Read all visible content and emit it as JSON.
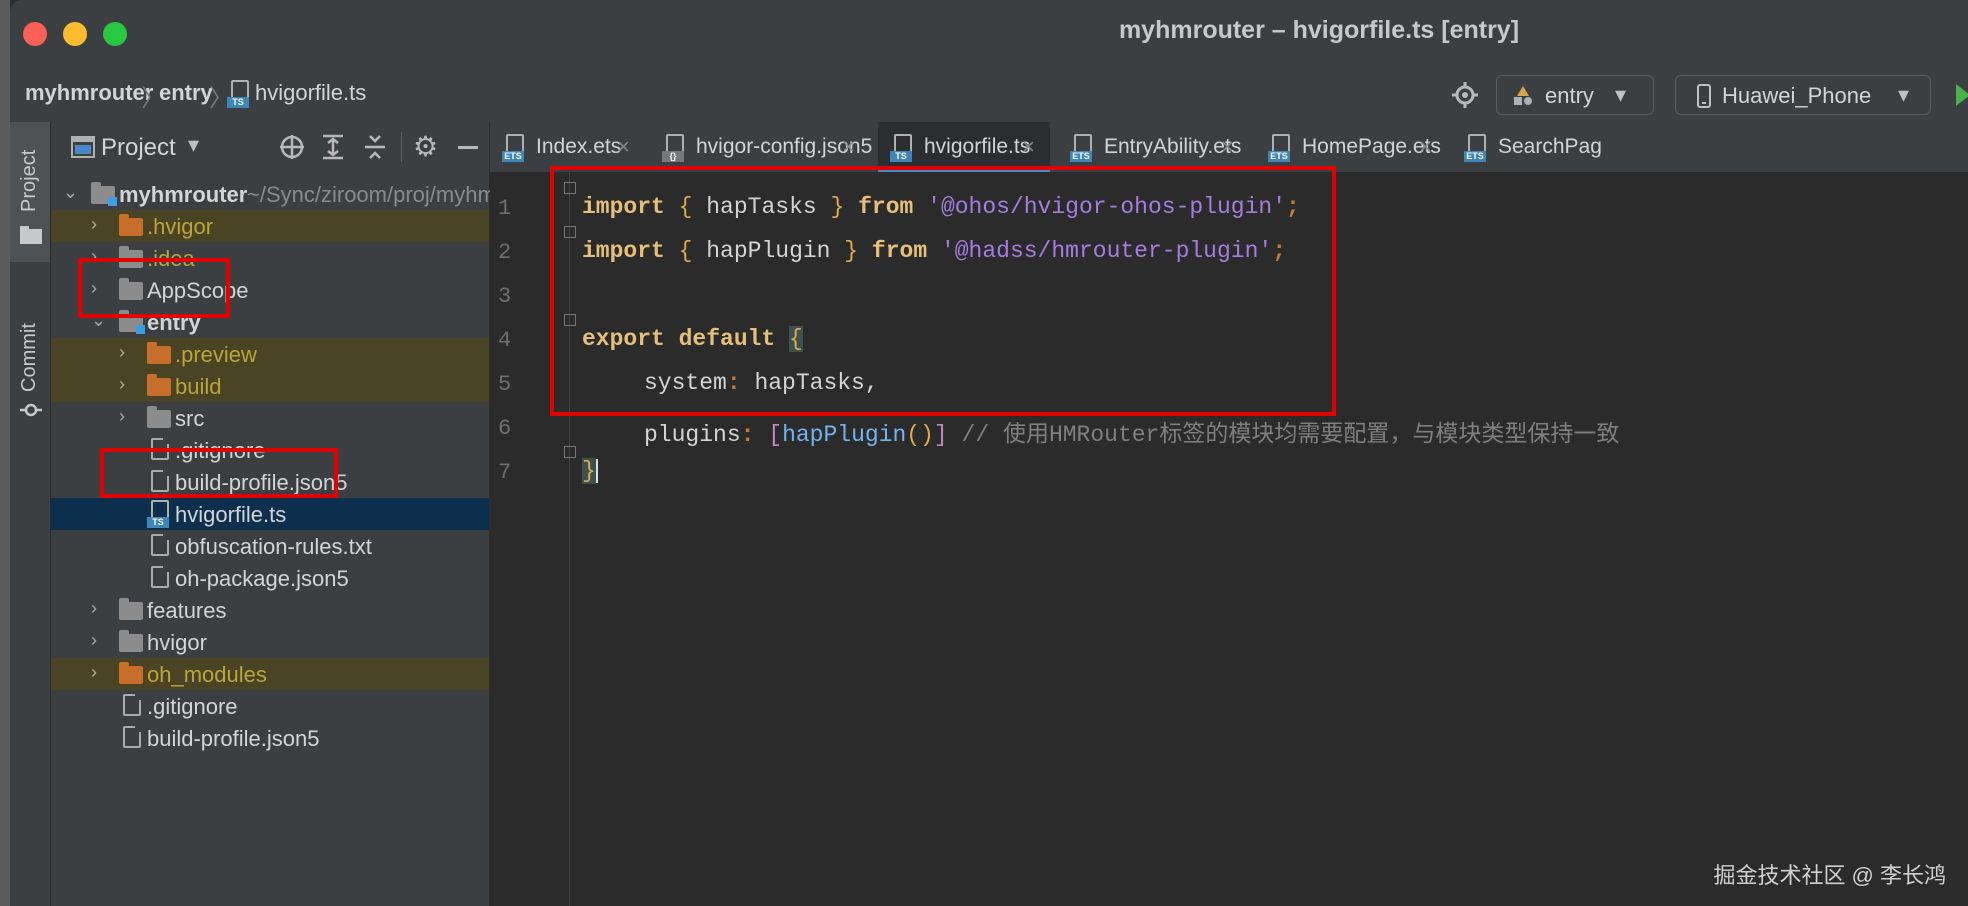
{
  "window": {
    "title": "myhmrouter – hvigorfile.ts [entry]"
  },
  "breadcrumb": [
    "myhmrouter",
    "entry",
    "hvigorfile.ts"
  ],
  "toolbar": {
    "module": "entry",
    "device": "Huawei_Phone"
  },
  "side_tabs": {
    "project": "Project",
    "commit": "Commit"
  },
  "project_panel": {
    "title": "Project",
    "tree": [
      {
        "label": "myhmrouter",
        "suffix": "~/Sync/ziroom/proj/myhm",
        "type": "module-root",
        "expanded": true
      },
      {
        "label": ".hvigor",
        "type": "folder-excluded"
      },
      {
        "label": ".idea",
        "type": "folder-gray-text"
      },
      {
        "label": "AppScope",
        "type": "folder"
      },
      {
        "label": "entry",
        "type": "module",
        "expanded": true
      },
      {
        "label": ".preview",
        "type": "folder-excluded"
      },
      {
        "label": "build",
        "type": "folder-excluded"
      },
      {
        "label": "src",
        "type": "folder"
      },
      {
        "label": ".gitignore",
        "type": "file"
      },
      {
        "label": "build-profile.json5",
        "type": "file"
      },
      {
        "label": "hvigorfile.ts",
        "type": "file-ts",
        "selected": true
      },
      {
        "label": "obfuscation-rules.txt",
        "type": "file"
      },
      {
        "label": "oh-package.json5",
        "type": "file"
      },
      {
        "label": "features",
        "type": "folder"
      },
      {
        "label": "hvigor",
        "type": "folder"
      },
      {
        "label": "oh_modules",
        "type": "folder-excluded"
      },
      {
        "label": ".gitignore",
        "type": "file"
      },
      {
        "label": "build-profile.json5",
        "type": "file"
      }
    ]
  },
  "editor_tabs": [
    {
      "label": "Index.ets",
      "icon": "ets-file-icon"
    },
    {
      "label": "hvigor-config.json5",
      "icon": "json-file-icon"
    },
    {
      "label": "hvigorfile.ts",
      "icon": "ts-file-icon",
      "active": true
    },
    {
      "label": "EntryAbility.ets",
      "icon": "ets-file-icon"
    },
    {
      "label": "HomePage.ets",
      "icon": "ets-file-icon"
    },
    {
      "label": "SearchPag",
      "icon": "ets-file-icon"
    }
  ],
  "code": {
    "line_numbers": [
      "1",
      "2",
      "3",
      "4",
      "5",
      "6",
      "7"
    ],
    "l1": {
      "kw": "import",
      "b1": "{",
      "id": " hapTasks ",
      "b2": "}",
      "from": "from",
      "str": "'@ohos/hvigor-ohos-plugin'",
      "semi": ";"
    },
    "l2": {
      "kw": "import",
      "b1": "{",
      "id": " hapPlugin ",
      "b2": "}",
      "from": "from",
      "str": "'@hadss/hmrouter-plugin'",
      "semi": ";"
    },
    "l4": {
      "kw": "export default",
      "b": "{"
    },
    "l5": {
      "key": "system",
      "val": " hapTasks,"
    },
    "l6": {
      "key": "plugins",
      "b1": "[",
      "fn": "hapPlugin",
      "p": "()",
      "b2": "]",
      "comment": "// 使用HMRouter标签的模块均需要配置，与模块类型保持一致"
    },
    "l7": {
      "b": "}"
    }
  },
  "watermark": "掘金技术社区 @ 李长鸿",
  "colors": {
    "annotation_box": "#e00000",
    "selection": "#0d2f4e",
    "excluded_folder": "#c66e2a"
  }
}
